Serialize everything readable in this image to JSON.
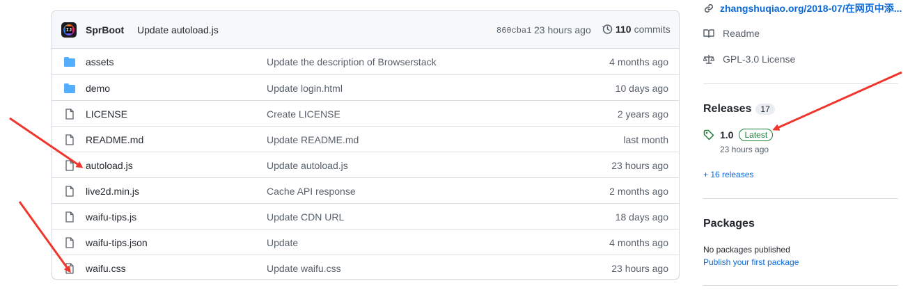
{
  "commit_bar": {
    "author": "SprBoot",
    "message": "Update autoload.js",
    "sha": "860cba1",
    "time": "23 hours ago",
    "commit_count": "110",
    "commit_label": "commits"
  },
  "files": [
    {
      "type": "dir",
      "name": "assets",
      "commit": "Update the description of Browserstack",
      "age": "4 months ago"
    },
    {
      "type": "dir",
      "name": "demo",
      "commit": "Update login.html",
      "age": "10 days ago"
    },
    {
      "type": "file",
      "name": "LICENSE",
      "commit": "Create LICENSE",
      "age": "2 years ago"
    },
    {
      "type": "file",
      "name": "README.md",
      "commit": "Update README.md",
      "age": "last month"
    },
    {
      "type": "file",
      "name": "autoload.js",
      "commit": "Update autoload.js",
      "age": "23 hours ago"
    },
    {
      "type": "file",
      "name": "live2d.min.js",
      "commit": "Cache API response",
      "age": "2 months ago"
    },
    {
      "type": "file",
      "name": "waifu-tips.js",
      "commit": "Update CDN URL",
      "age": "18 days ago"
    },
    {
      "type": "file",
      "name": "waifu-tips.json",
      "commit": "Update",
      "age": "4 months ago"
    },
    {
      "type": "file",
      "name": "waifu.css",
      "commit": "Update waifu.css",
      "age": "23 hours ago"
    }
  ],
  "sidebar": {
    "website": "zhangshuqiao.org/2018-07/在网页中添...",
    "readme": "Readme",
    "license": "GPL-3.0 License",
    "releases": {
      "heading": "Releases",
      "count": "17",
      "tag": "1.0",
      "latest_label": "Latest",
      "time": "23 hours ago",
      "more": "+ 16 releases"
    },
    "packages": {
      "heading": "Packages",
      "empty_text": "No packages published",
      "publish_link": "Publish your first package"
    }
  },
  "colors": {
    "link": "#0969da",
    "folder": "#54aeff",
    "latest": "#1a7f37",
    "annotation": "#f0362c"
  }
}
